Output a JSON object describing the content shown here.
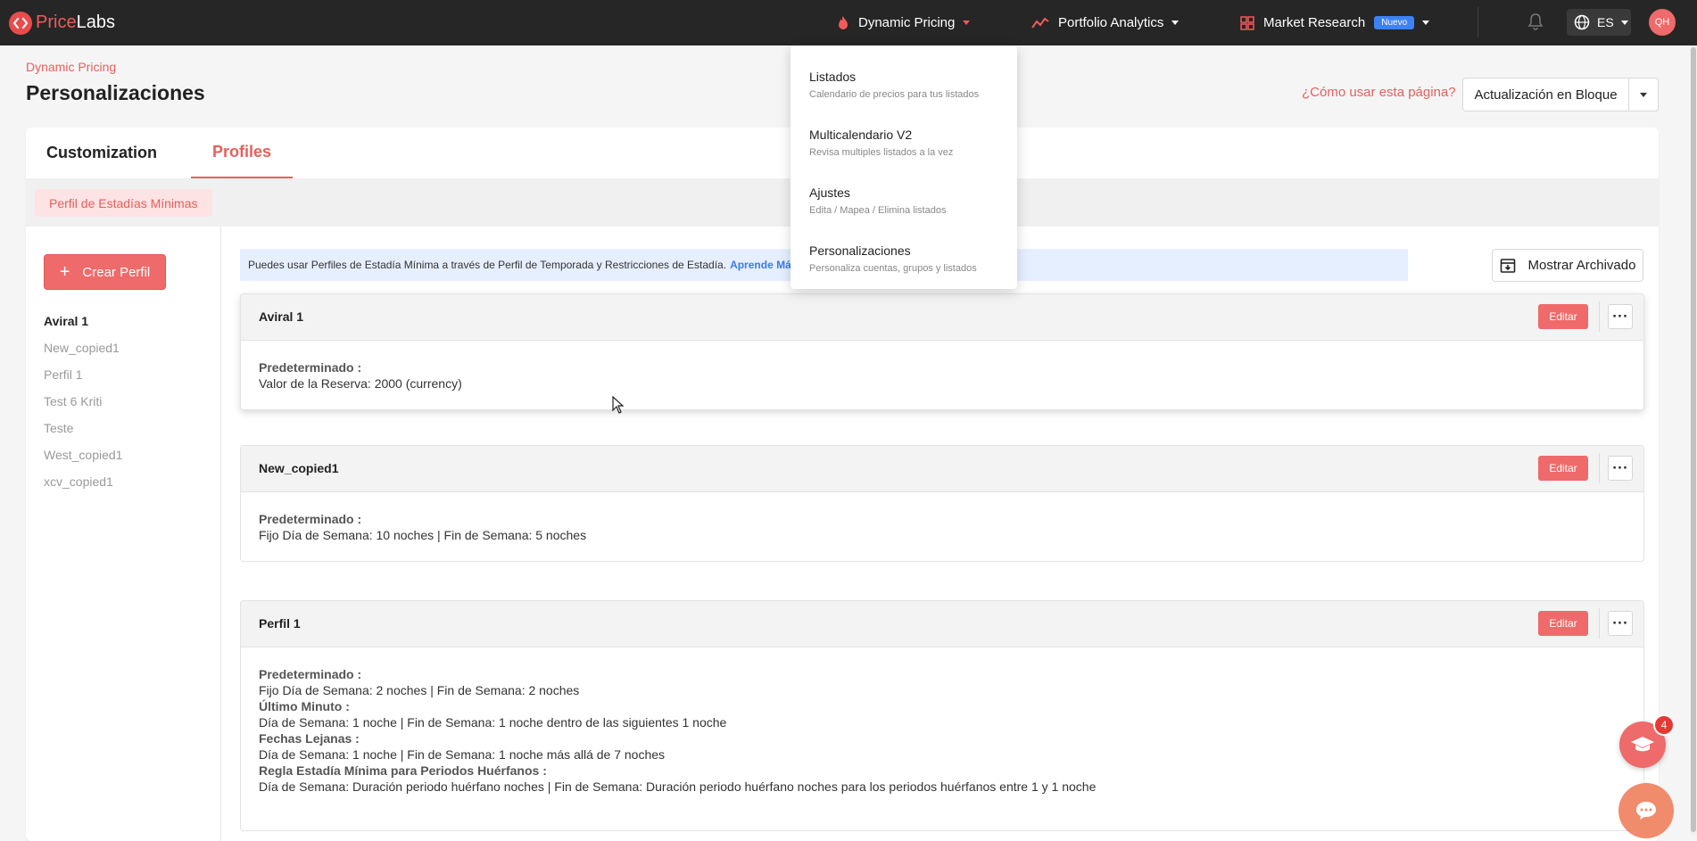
{
  "brand": {
    "name_part1": "Price",
    "name_part2": "Labs",
    "color": "#e94c4c"
  },
  "nav": {
    "dynamic_pricing": "Dynamic Pricing",
    "portfolio_analytics": "Portfolio Analytics",
    "market_research": "Market Research",
    "market_research_badge": "Nuevo",
    "language": "ES",
    "avatar_initials": "QH",
    "icons": {
      "dynamic_pricing": "fire-icon",
      "portfolio_analytics": "trend-line-icon",
      "market_research": "grid-icon",
      "notifications": "bell-icon",
      "language": "globe-icon"
    }
  },
  "dropdown": {
    "items": [
      {
        "title": "Listados",
        "subtitle": "Calendario de precios para tus listados"
      },
      {
        "title": "Multicalendario V2",
        "subtitle": "Revisa multiples listados a la vez"
      },
      {
        "title": "Ajustes",
        "subtitle": "Edita / Mapea / Elimina listados"
      },
      {
        "title": "Personalizaciones",
        "subtitle": "Personaliza cuentas, grupos y listados"
      }
    ]
  },
  "page": {
    "breadcrumb": "Dynamic Pricing",
    "title": "Personalizaciones",
    "help_link": "¿Cómo usar esta página?",
    "bulk_update": "Actualización en Bloque"
  },
  "tabs": {
    "customization": "Customization",
    "profiles": "Profiles"
  },
  "subtab": {
    "min_stay": "Perfil de Estadías Mínimas"
  },
  "sidebar": {
    "create_button": "Crear Perfil",
    "profiles": [
      "Aviral 1",
      "New_copied1",
      "Perfil 1",
      "Test 6 Kriti",
      "Teste",
      "West_copied1",
      "xcv_copied1"
    ]
  },
  "info": {
    "text": "Puedes usar Perfiles de Estadía Mínima a través de Perfil de Temporada y Restricciones de Estadía.",
    "link": "Aprende Más"
  },
  "archive_button": "Mostrar Archivado",
  "edit_label": "Editar",
  "profile_cards": [
    {
      "name": "Aviral 1",
      "lines": [
        {
          "text": "Predeterminado :",
          "bold": true
        },
        {
          "text": "Valor de la Reserva: 2000 (currency)",
          "bold": false
        }
      ]
    },
    {
      "name": "New_copied1",
      "lines": [
        {
          "text": "Predeterminado :",
          "bold": true
        },
        {
          "text": "Fijo Día de Semana: 10 noches | Fin de Semana: 5 noches",
          "bold": false
        }
      ]
    },
    {
      "name": "Perfil 1",
      "lines": [
        {
          "text": "Predeterminado :",
          "bold": true
        },
        {
          "text": "Fijo Día de Semana: 2 noches | Fin de Semana: 2 noches",
          "bold": false
        },
        {
          "text": "Último Minuto :",
          "bold": true
        },
        {
          "text": "Día de Semana: 1 noche | Fin de Semana: 1 noche dentro de las siguientes 1 noche",
          "bold": false
        },
        {
          "text": "Fechas Lejanas :",
          "bold": true
        },
        {
          "text": "Día de Semana: 1 noche | Fin de Semana: 1 noche más allá de 7 noches",
          "bold": false
        },
        {
          "text": "Regla Estadía Mínima para Periodos Huérfanos :",
          "bold": true
        },
        {
          "text": "Día de Semana: Duración periodo huérfano noches | Fin de Semana: Duración periodo huérfano noches para los periodos huérfanos entre 1 y 1 noche",
          "bold": false
        }
      ]
    }
  ],
  "help_widget": {
    "count": "4"
  },
  "colors": {
    "accent": "#e5605c",
    "button": "#ef6a6a",
    "topbar": "#262626",
    "info_bg": "#e6efff",
    "link_blue": "#3b7be6"
  }
}
